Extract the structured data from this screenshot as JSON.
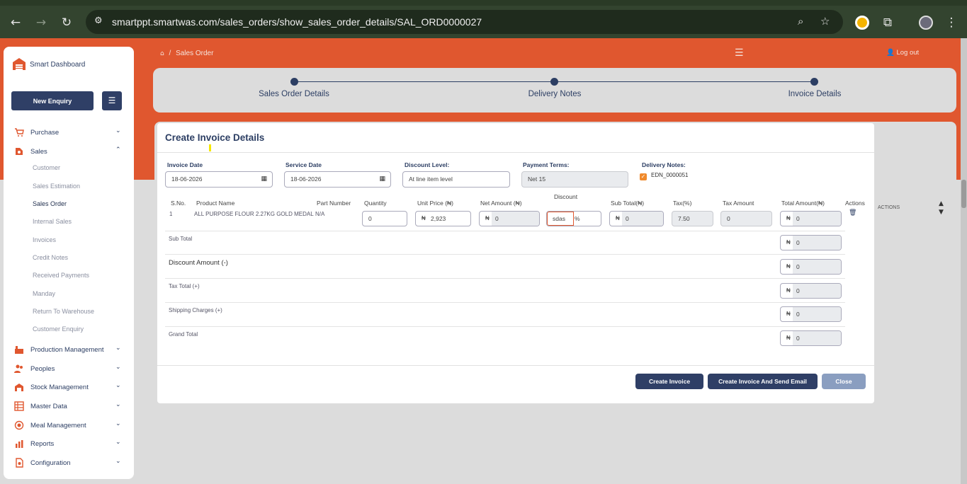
{
  "browser": {
    "url": "smartppt.smartwas.com/sales_orders/show_sales_order_details/SAL_ORD0000027"
  },
  "sidebar": {
    "brand": "Smart Dashboard",
    "new_enquiry": "New Enquiry",
    "items": [
      {
        "label": "Purchase",
        "icon": "cart-icon"
      },
      {
        "label": "Sales",
        "icon": "sales-icon"
      },
      {
        "label": "Production Management",
        "icon": "production-icon"
      },
      {
        "label": "Peoples",
        "icon": "people-icon"
      },
      {
        "label": "Stock Management",
        "icon": "stock-icon"
      },
      {
        "label": "Master Data",
        "icon": "master-data-icon"
      },
      {
        "label": "Meal Management",
        "icon": "meal-icon"
      },
      {
        "label": "Reports",
        "icon": "reports-icon"
      },
      {
        "label": "Configuration",
        "icon": "config-icon"
      }
    ],
    "sales_sub": [
      "Customer",
      "Sales Estimation",
      "Sales Order",
      "Internal Sales",
      "Invoices",
      "Credit Notes",
      "Received Payments",
      "Manday",
      "Return To Warehouse",
      "Customer Enquiry"
    ],
    "active_sub": "Sales Order"
  },
  "header": {
    "breadcrumb_sep": "/",
    "breadcrumb": "Sales Order",
    "logout": "Log out"
  },
  "stepper": [
    "Sales Order Details",
    "Delivery Notes",
    "Invoice Details"
  ],
  "under": {
    "actions": "ACTIONS"
  },
  "modal": {
    "title": "Create Invoice Details",
    "invoice_date_label": "Invoice Date",
    "invoice_date": "18-06-2026",
    "service_date_label": "Service Date",
    "service_date": "18-06-2026",
    "discount_level_label": "Discount Level:",
    "discount_level": "At line item level",
    "payment_terms_label": "Payment Terms:",
    "payment_terms": "Net 15",
    "delivery_notes_label": "Delivery Notes:",
    "delivery_note": "EDN_0000051",
    "columns": {
      "sno": "S.No.",
      "product": "Product Name",
      "part": "Part Number",
      "qty": "Quantity",
      "unit_price": "Unit Price (₦)",
      "net_amount": "Net Amount (₦)",
      "discount": "Discount",
      "sub_total": "Sub Total(₦)",
      "tax": "Tax(%)",
      "tax_amount": "Tax Amount",
      "total_amount": "Total Amount(₦)",
      "actions": "Actions"
    },
    "row": {
      "sno": "1",
      "product": "ALL PURPOSE FLOUR 2.27KG GOLD MEDAL",
      "part": "N/A",
      "qty": "0",
      "unit_price": "2,923",
      "net_amount": "0",
      "discount": "sdas",
      "discount_unit": "%",
      "sub_total": "0",
      "tax": "7.50",
      "tax_amount": "0",
      "total_amount": "0"
    },
    "currency": "₦",
    "summary": [
      {
        "label": "Sub Total",
        "value": "0"
      },
      {
        "label": "Discount Amount (-)",
        "value": "0"
      },
      {
        "label": "Tax Total (+)",
        "value": "0"
      },
      {
        "label": "Shipping Charges (+)",
        "value": "0"
      },
      {
        "label": "Grand Total",
        "value": "0"
      }
    ],
    "buttons": {
      "create": "Create Invoice",
      "create_email": "Create Invoice And Send Email",
      "close": "Close"
    }
  },
  "colors": {
    "brand_orange": "#e0572f",
    "navy": "#2f3f66",
    "close_button": "#8a9ec0"
  }
}
